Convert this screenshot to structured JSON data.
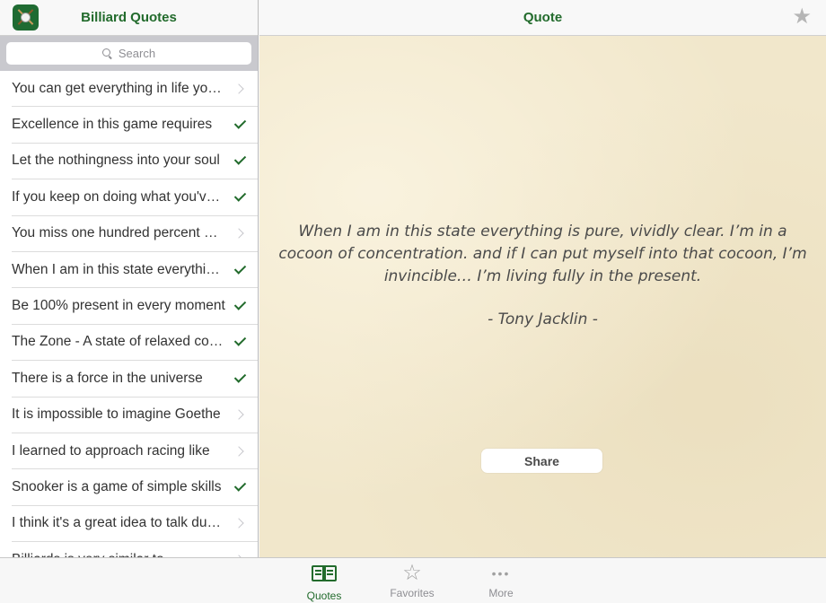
{
  "sidebar": {
    "title": "Billiard Quotes",
    "search_placeholder": "Search",
    "items": [
      {
        "text": "You can get everything in life you want",
        "status": "unread"
      },
      {
        "text": "Excellence in this game requires",
        "status": "read"
      },
      {
        "text": "Let the nothingness into your soul",
        "status": "read"
      },
      {
        "text": "If you keep on doing what you've always done",
        "status": "read"
      },
      {
        "text": "You miss one hundred percent of the shots",
        "status": "unread"
      },
      {
        "text": "When I am in this state everything is pure",
        "status": "read"
      },
      {
        "text": "Be 100% present in every moment",
        "status": "read"
      },
      {
        "text": "The Zone - A state of relaxed concentration",
        "status": "read"
      },
      {
        "text": "There is a force in the universe",
        "status": "read"
      },
      {
        "text": "It is impossible to imagine Goethe",
        "status": "unread"
      },
      {
        "text": "I learned to approach racing like",
        "status": "unread"
      },
      {
        "text": "Snooker is a game of simple skills",
        "status": "read"
      },
      {
        "text": "I think it's a great idea to talk during",
        "status": "unread"
      },
      {
        "text": "Billiards is very similar to",
        "status": "unread"
      }
    ]
  },
  "detail": {
    "title": "Quote",
    "quote": "When I am in this state everything is pure, vividly clear. I’m in a cocoon of concentration. and if I can put myself into that cocoon, I’m invincible… I’m living fully in the present.",
    "author": "-  Tony Jacklin  -",
    "share_label": "Share"
  },
  "tabs": {
    "quotes": "Quotes",
    "favorites": "Favorites",
    "more": "More"
  },
  "colors": {
    "accent": "#226b2c",
    "parchment": "#f1e7cb"
  }
}
